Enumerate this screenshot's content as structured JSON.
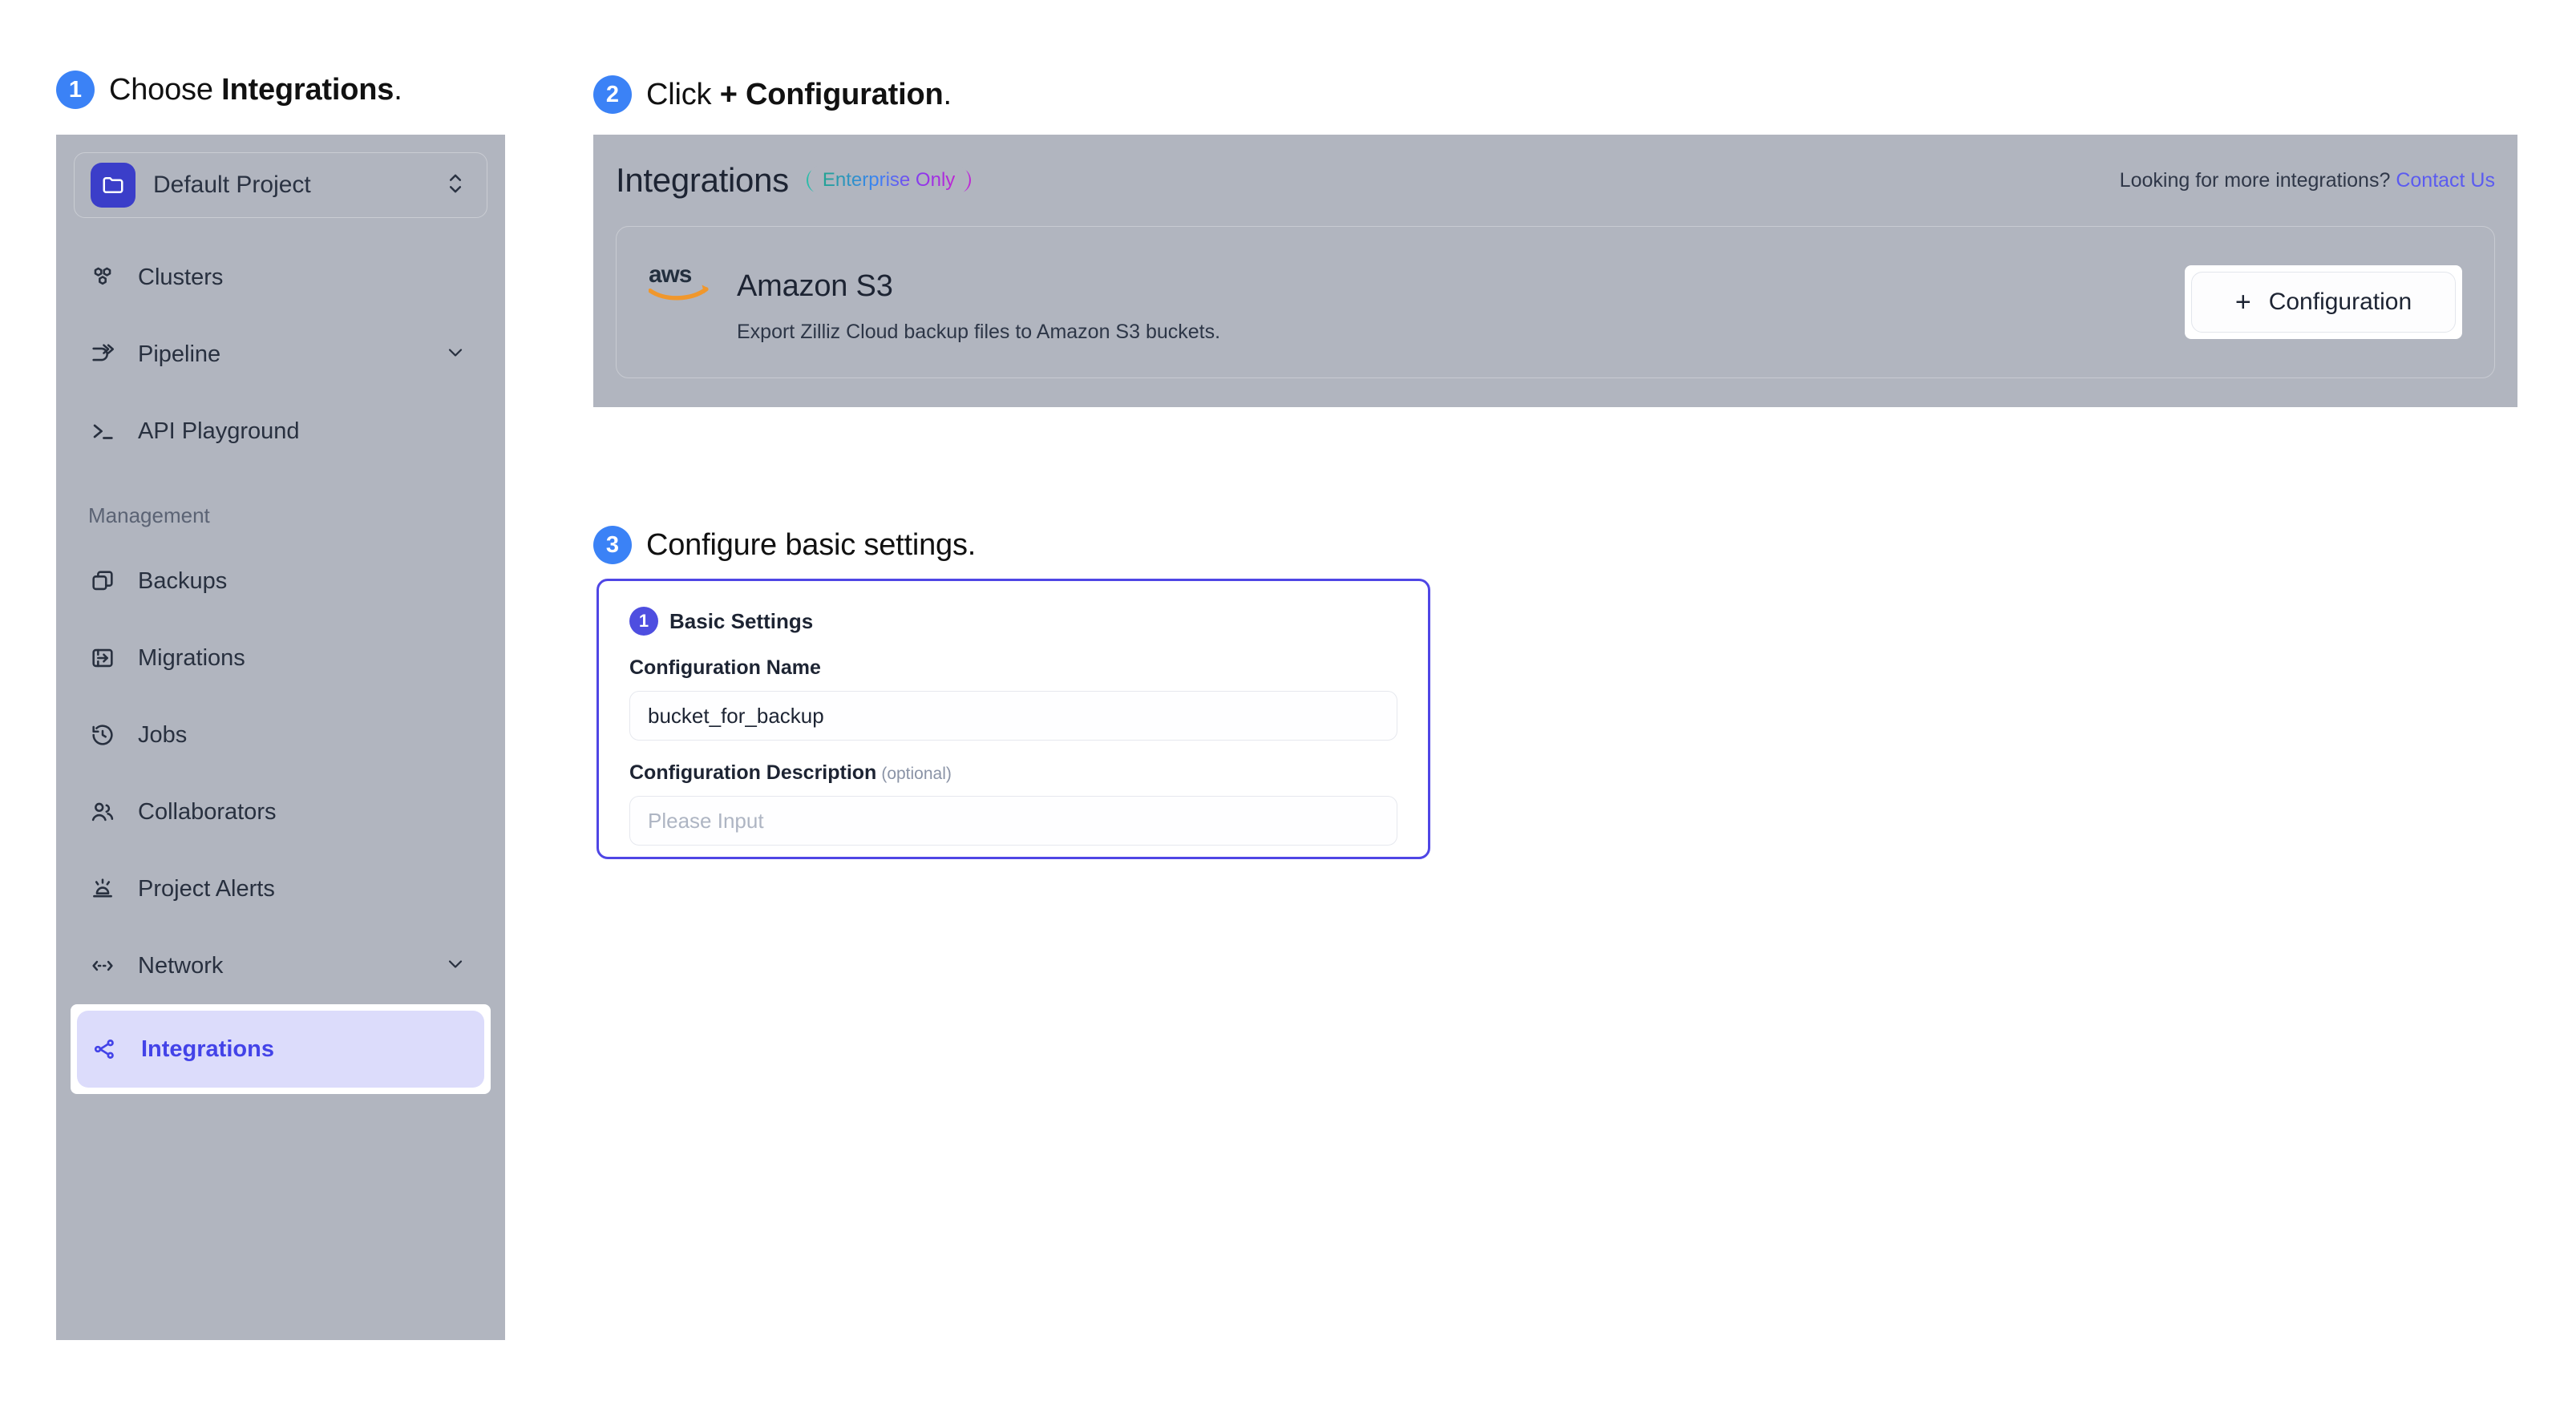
{
  "steps": [
    {
      "number": "1",
      "prefix": "Choose ",
      "bold": "Integrations",
      "suffix": "."
    },
    {
      "number": "2",
      "prefix": "Click ",
      "bold": "+ Configuration",
      "suffix": "."
    },
    {
      "number": "3",
      "prefix": "Configure basic settings.",
      "bold": "",
      "suffix": ""
    }
  ],
  "sidebar": {
    "project": {
      "name": "Default Project"
    },
    "nav": [
      {
        "label": "Clusters",
        "icon": "clusters-icon",
        "chevron": false
      },
      {
        "label": "Pipeline",
        "icon": "pipeline-icon",
        "chevron": true
      },
      {
        "label": "API Playground",
        "icon": "terminal-icon",
        "chevron": false
      }
    ],
    "section_title": "Management",
    "management": [
      {
        "label": "Backups",
        "icon": "backups-icon",
        "chevron": false
      },
      {
        "label": "Migrations",
        "icon": "migrations-icon",
        "chevron": false
      },
      {
        "label": "Jobs",
        "icon": "jobs-icon",
        "chevron": false
      },
      {
        "label": "Collaborators",
        "icon": "collaborators-icon",
        "chevron": false
      },
      {
        "label": "Project Alerts",
        "icon": "alerts-icon",
        "chevron": false
      },
      {
        "label": "Network",
        "icon": "network-icon",
        "chevron": true
      }
    ],
    "active_item": {
      "label": "Integrations",
      "icon": "integrations-icon"
    }
  },
  "integrations_panel": {
    "title": "Integrations",
    "badge": "Enterprise Only",
    "header_right_text": "Looking for more integrations? ",
    "header_right_link": "Contact Us",
    "card": {
      "logo": "aws-logo",
      "title": "Amazon S3",
      "description": "Export Zilliz Cloud backup files to Amazon S3 buckets.",
      "button_label": "Configuration",
      "button_plus": "+"
    }
  },
  "basic_settings": {
    "badge": "1",
    "title": "Basic Settings",
    "name_label": "Configuration Name",
    "name_value": "bucket_for_backup",
    "description_label": "Configuration Description",
    "description_optional": "(optional)",
    "description_placeholder": "Please Input"
  },
  "colors": {
    "step_badge": "#3b82f6",
    "sidebar_bg": "#b1b5bf",
    "active_pill": "#dcdcfb",
    "active_text": "#4343e8",
    "card_border": "#4f46e5",
    "link": "#5b5bf0",
    "aws_orange": "#f0972c",
    "project_icon": "#3b3ec9"
  }
}
